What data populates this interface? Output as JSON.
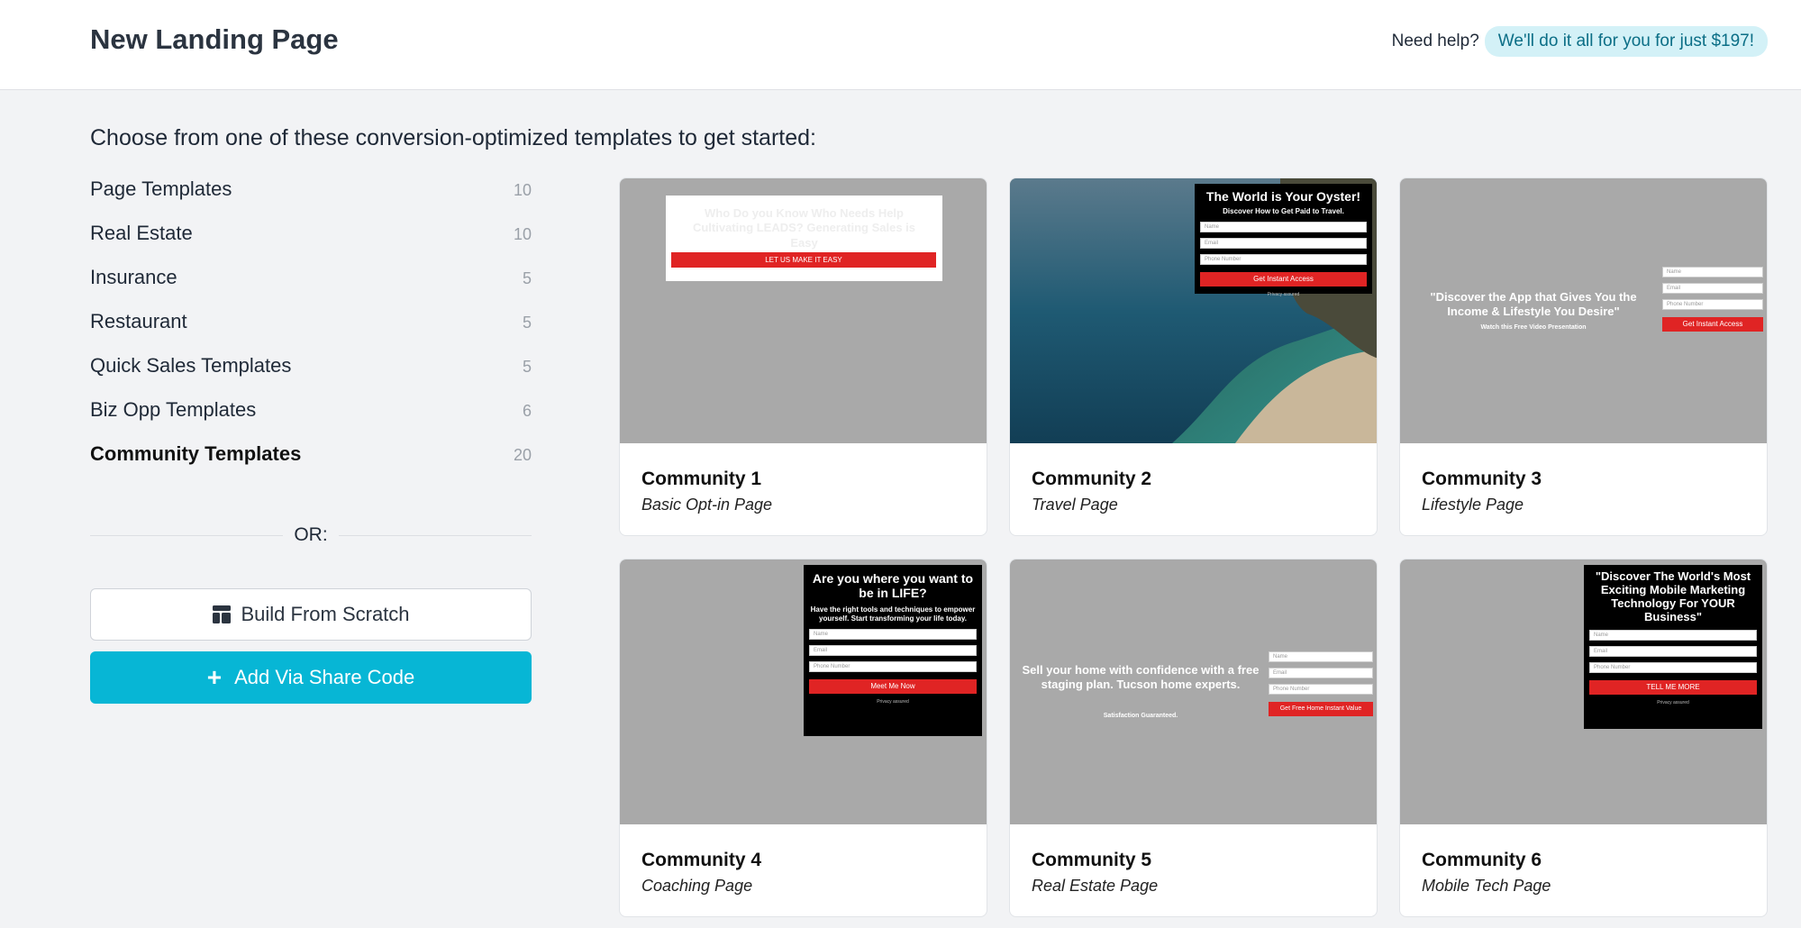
{
  "header": {
    "title": "New Landing Page",
    "help_text": "Need help?",
    "help_pill": "We'll do it all for you for just $197!"
  },
  "intro": "Choose from one of these conversion-optimized templates to get started:",
  "categories": [
    {
      "label": "Page Templates",
      "count": "10"
    },
    {
      "label": "Real Estate",
      "count": "10"
    },
    {
      "label": "Insurance",
      "count": "5"
    },
    {
      "label": "Restaurant",
      "count": "5"
    },
    {
      "label": "Quick Sales Templates",
      "count": "5"
    },
    {
      "label": "Biz Opp Templates",
      "count": "6"
    },
    {
      "label": "Community Templates",
      "count": "20",
      "active": true
    }
  ],
  "or_label": "OR:",
  "buttons": {
    "scratch": "Build From Scratch",
    "share": "Add Via Share Code"
  },
  "colors": {
    "accent": "#07b6d5",
    "form_button": "#e02424",
    "thumb_gray": "#a9a9a9"
  },
  "templates": [
    {
      "title": "Community 1",
      "subtitle": "Basic Opt-in Page",
      "thumb": {
        "headline": "Who Do you Know Who Needs Help Cultivating LEADS? Generating Sales is Easy",
        "button": "LET US MAKE IT EASY"
      }
    },
    {
      "title": "Community 2",
      "subtitle": "Travel Page",
      "thumb": {
        "headline": "The World is Your Oyster!",
        "sub": "Discover How to Get Paid to Travel.",
        "inputs": [
          "Name",
          "Email",
          "Phone Number"
        ],
        "button": "Get Instant Access",
        "privacy": "Privacy assured"
      }
    },
    {
      "title": "Community 3",
      "subtitle": "Lifestyle Page",
      "thumb": {
        "headline": "\"Discover the App that Gives You the Income & Lifestyle You Desire\"",
        "sub": "Watch this Free Video Presentation",
        "inputs": [
          "Name",
          "Email",
          "Phone Number"
        ],
        "button": "Get Instant Access"
      }
    },
    {
      "title": "Community 4",
      "subtitle": "Coaching Page",
      "thumb": {
        "headline": "Are you where you want to be in LIFE?",
        "sub": "Have the right tools and techniques to empower yourself. Start transforming your life today.",
        "inputs": [
          "Name",
          "Email",
          "Phone Number"
        ],
        "button": "Meet Me Now",
        "privacy": "Privacy assured"
      }
    },
    {
      "title": "Community 5",
      "subtitle": "Real Estate Page",
      "thumb": {
        "headline": "Sell your home with confidence with a free staging plan. Tucson home experts.",
        "sub": "Satisfaction Guaranteed.",
        "inputs": [
          "Name",
          "Email",
          "Phone Number"
        ],
        "button": "Get Free Home Instant Value"
      }
    },
    {
      "title": "Community 6",
      "subtitle": "Mobile Tech Page",
      "thumb": {
        "headline": "\"Discover The World's Most Exciting Mobile Marketing Technology For YOUR Business\"",
        "inputs": [
          "Name",
          "Email",
          "Phone Number"
        ],
        "button": "TELL ME MORE",
        "privacy": "Privacy assured"
      }
    }
  ]
}
